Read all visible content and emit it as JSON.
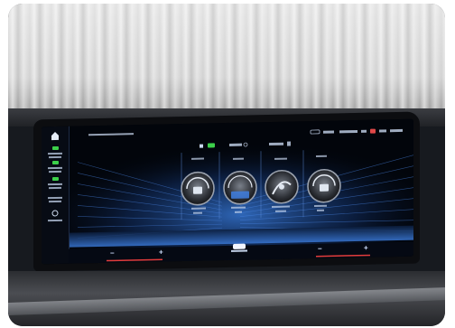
{
  "screen": {
    "title": "",
    "status_bar": {
      "time": ""
    },
    "climate": {
      "ac_label": "",
      "sync_label": ""
    },
    "sidebar": {
      "items": [
        {
          "label": ""
        },
        {
          "label": ""
        },
        {
          "label": ""
        },
        {
          "label": ""
        }
      ]
    },
    "dials": [
      {
        "label": ""
      },
      {
        "label": ""
      },
      {
        "label": ""
      },
      {
        "label": ""
      }
    ],
    "bottom_bar": {
      "left_temp": "",
      "right_temp": "",
      "minus": "−",
      "plus": "+"
    },
    "colors": {
      "screen_bg": "#02050b",
      "glow": "#2a6fdd",
      "active_indicator": "#3cd04a"
    },
    "icons": [
      "home-icon",
      "fan-icon",
      "seat-heat-icon"
    ]
  }
}
